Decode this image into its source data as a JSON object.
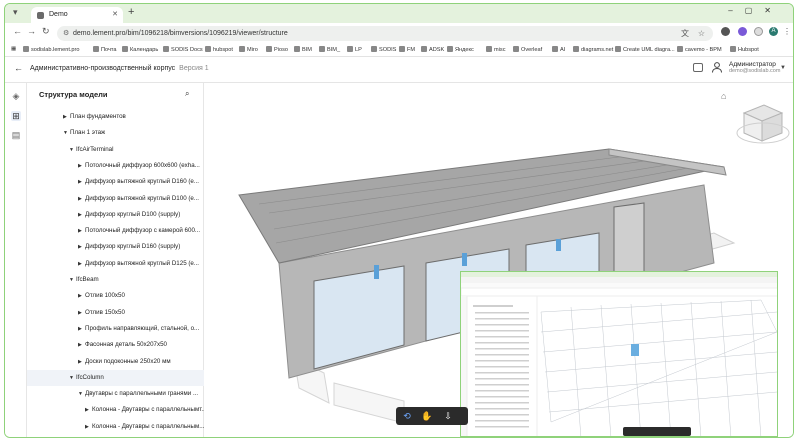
{
  "browser": {
    "tab_title": "Demo",
    "url": "demo.lement.pro/bim/1096218/bimversions/1096219/viewer/structure",
    "profile_initial": "A"
  },
  "bookmarks": [
    "sodislab.lement.pro",
    "Почта",
    "Календарь",
    "SODIS Docs",
    "hubspot",
    "Miro",
    "Pioso",
    "BIM",
    "BIM_",
    "LP",
    "SODIS",
    "FM",
    "ADSK",
    "Яндекс",
    "misc",
    "Overleaf",
    "AI",
    "diagrams.net",
    "Create UML diagra...",
    "cavemo - BPM",
    "Hubspot"
  ],
  "app": {
    "project_title": "Административно-производственный корпус",
    "version": "Версия 1",
    "user_name": "Администратор",
    "user_email": "demo@sodislab.com"
  },
  "tree": {
    "heading": "Структура модели",
    "rows": [
      {
        "label": "План фундаментов",
        "level": 1,
        "open": false
      },
      {
        "label": "План 1 этаж",
        "level": 1,
        "open": true
      },
      {
        "label": "IfcAirTerminal",
        "level": 2,
        "open": true
      },
      {
        "label": "Потолочный диффузор 600x600 (exha...",
        "level": 3,
        "open": false
      },
      {
        "label": "Диффузор вытяжной круглый D160 (e...",
        "level": 3,
        "open": false
      },
      {
        "label": "Диффузор вытяжной круглый D100 (e...",
        "level": 3,
        "open": false
      },
      {
        "label": "Диффузор круглый D100 (supply)",
        "level": 3,
        "open": false
      },
      {
        "label": "Потолочный диффузор с камерой 600...",
        "level": 3,
        "open": false
      },
      {
        "label": "Диффузор круглый D160 (supply)",
        "level": 3,
        "open": false
      },
      {
        "label": "Диффузор вытяжной круглый D125 (e...",
        "level": 3,
        "open": false
      },
      {
        "label": "IfcBeam",
        "level": 2,
        "open": true
      },
      {
        "label": "Отлив 100x50",
        "level": 3,
        "open": false
      },
      {
        "label": "Отлив 150x50",
        "level": 3,
        "open": false
      },
      {
        "label": "Профиль направляющий, стальной, о...",
        "level": 3,
        "open": false
      },
      {
        "label": "Фасонная деталь 50x207x50",
        "level": 3,
        "open": false
      },
      {
        "label": "Доски подоконные 250x20 мм",
        "level": 3,
        "open": false
      },
      {
        "label": "IfcColumn",
        "level": 2,
        "open": true,
        "selected": true
      },
      {
        "label": "Двутавры с параллельными гранями ...",
        "level": 3,
        "open": true
      },
      {
        "label": "Колонна - Двутавры с параллельнымт...",
        "level": 4,
        "open": false
      },
      {
        "label": "Колонна - Двутавры с параллельным...",
        "level": 4,
        "open": false
      }
    ]
  },
  "viewer": {
    "tools": [
      "orbit-icon",
      "hand-icon",
      "pan-arrow-icon"
    ],
    "active_tool": "orbit-icon"
  },
  "colors": {
    "frame": "#8fd27a",
    "tabbar": "#e4f2dd",
    "accent": "#6fa8ff",
    "toolbar": "#2b2b2b"
  }
}
